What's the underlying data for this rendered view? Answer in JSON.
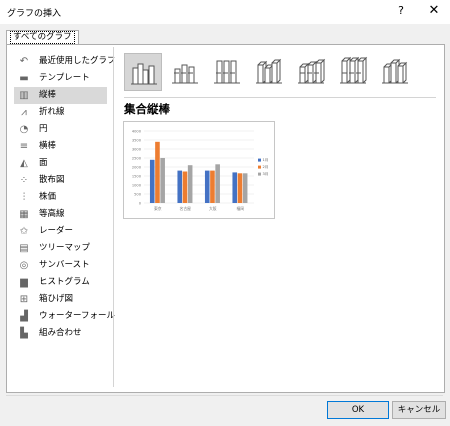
{
  "window": {
    "title": "グラフの挿入",
    "help_icon": "?",
    "close_icon": "✕"
  },
  "tab": {
    "label": "すべてのグラフ"
  },
  "sidebar": {
    "selected_index": 2,
    "items": [
      {
        "label": "最近使用したグラフ",
        "icon": "undo-arrow-icon",
        "glyph": "↶"
      },
      {
        "label": "テンプレート",
        "icon": "folder-icon",
        "glyph": "▬"
      },
      {
        "label": "縦棒",
        "icon": "column-chart-icon",
        "glyph": "▥"
      },
      {
        "label": "折れ線",
        "icon": "line-chart-icon",
        "glyph": "⩘"
      },
      {
        "label": "円",
        "icon": "pie-chart-icon",
        "glyph": "◔"
      },
      {
        "label": "横棒",
        "icon": "bar-chart-icon",
        "glyph": "≡"
      },
      {
        "label": "面",
        "icon": "area-chart-icon",
        "glyph": "◭"
      },
      {
        "label": "散布図",
        "icon": "scatter-chart-icon",
        "glyph": "⁘"
      },
      {
        "label": "株価",
        "icon": "stock-chart-icon",
        "glyph": "⫶"
      },
      {
        "label": "等高線",
        "icon": "surface-chart-icon",
        "glyph": "▦"
      },
      {
        "label": "レーダー",
        "icon": "radar-chart-icon",
        "glyph": "✩"
      },
      {
        "label": "ツリーマップ",
        "icon": "treemap-chart-icon",
        "glyph": "▤"
      },
      {
        "label": "サンバースト",
        "icon": "sunburst-chart-icon",
        "glyph": "◎"
      },
      {
        "label": "ヒストグラム",
        "icon": "histogram-chart-icon",
        "glyph": "▆"
      },
      {
        "label": "箱ひげ図",
        "icon": "box-whisker-chart-icon",
        "glyph": "⊞"
      },
      {
        "label": "ウォーターフォール",
        "icon": "waterfall-chart-icon",
        "glyph": "▟"
      },
      {
        "label": "組み合わせ",
        "icon": "combo-chart-icon",
        "glyph": "▙"
      }
    ]
  },
  "subtypes": {
    "selected_index": 0,
    "items": [
      {
        "icon": "clustered-column-icon"
      },
      {
        "icon": "stacked-column-icon"
      },
      {
        "icon": "100-stacked-column-icon"
      },
      {
        "icon": "3d-clustered-column-icon"
      },
      {
        "icon": "3d-stacked-column-icon"
      },
      {
        "icon": "3d-100-stacked-column-icon"
      },
      {
        "icon": "3d-column-icon"
      }
    ]
  },
  "chart_name": "集合縦棒",
  "preview": {
    "colors": {
      "accent_blue": "#4472c4",
      "accent_orange": "#ed7d31",
      "accent_gray": "#a5a5a5"
    },
    "chart_data": {
      "type": "bar",
      "categories": [
        "東京",
        "名古屋",
        "大阪",
        "福岡"
      ],
      "series": [
        {
          "name": "1月",
          "values": [
            2400,
            1800,
            1800,
            1700
          ]
        },
        {
          "name": "2月",
          "values": [
            3400,
            1750,
            1800,
            1650
          ]
        },
        {
          "name": "3月",
          "values": [
            2500,
            2100,
            2150,
            1650
          ]
        }
      ],
      "ylim": [
        0,
        4000
      ],
      "yticks": [
        "4000",
        "3500",
        "3000",
        "2500",
        "2000",
        "1500",
        "1000",
        "500",
        "0"
      ],
      "grid": true,
      "legend": "right"
    }
  },
  "footer": {
    "ok_label": "OK",
    "cancel_label": "キャンセル"
  }
}
